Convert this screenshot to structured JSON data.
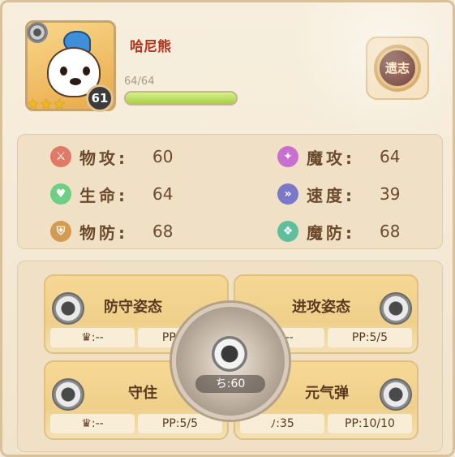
{
  "pet": {
    "name": "哈尼熊",
    "level": "61",
    "stars": [
      "★",
      "★",
      "★"
    ],
    "hp_text": "64/64",
    "hp_fraction": 1.0
  },
  "legacy_button": {
    "label": "遗志"
  },
  "stats": [
    {
      "label": "物攻:",
      "value": "60",
      "icon": "sword-icon",
      "icon_glyph": "⚔",
      "color": "#e07a67"
    },
    {
      "label": "生命:",
      "value": "64",
      "icon": "heart-icon",
      "icon_glyph": "♥",
      "color": "#6ccf83"
    },
    {
      "label": "物防:",
      "value": "68",
      "icon": "shield-icon",
      "icon_glyph": "⛨",
      "color": "#d39a52"
    },
    {
      "label": "魔攻:",
      "value": "64",
      "icon": "wand-icon",
      "icon_glyph": "✦",
      "color": "#c96fcf"
    },
    {
      "label": "速度:",
      "value": "39",
      "icon": "speed-icon",
      "icon_glyph": "»",
      "color": "#7b78c9"
    },
    {
      "label": "魔防:",
      "value": "68",
      "icon": "magic-shield-icon",
      "icon_glyph": "❖",
      "color": "#5fbf9c"
    }
  ],
  "skills": [
    {
      "name": "防守姿态",
      "cost": ":--",
      "pp": "PP:5/5",
      "icon_glyph": "♛"
    },
    {
      "name": "进攻姿态",
      "cost": ":--",
      "pp": "PP:5/5",
      "icon_glyph": "♛"
    },
    {
      "name": "守住",
      "cost": ":--",
      "pp": "PP:5/5",
      "icon_glyph": "♛"
    },
    {
      "name": "元气弹",
      "cost": ":35",
      "pp": "PP:10/10",
      "icon_glyph": "ﾉ"
    }
  ],
  "ultimate": {
    "label": ":60",
    "icon_glyph": "ち"
  }
}
